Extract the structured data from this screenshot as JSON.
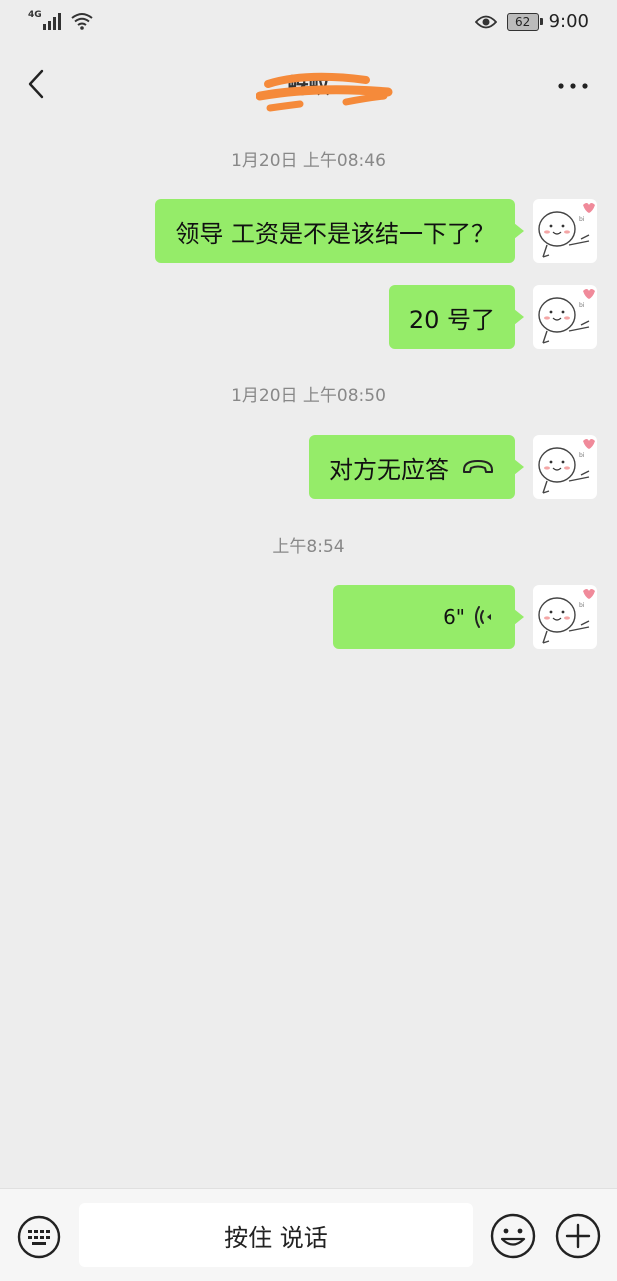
{
  "status_bar": {
    "network": "4G",
    "battery": "62",
    "time": "9:00"
  },
  "header": {
    "title": "蚜蚊"
  },
  "messages": [
    {
      "type": "timestamp",
      "text": "1月20日 上午08:46"
    },
    {
      "type": "text",
      "text": "领导  工资是不是该结一下了？"
    },
    {
      "type": "text",
      "text": "20 号了"
    },
    {
      "type": "timestamp",
      "text": "1月20日 上午08:50"
    },
    {
      "type": "call",
      "text": "对方无应答",
      "icon": "hangup-icon"
    },
    {
      "type": "timestamp",
      "text": "上午8:54"
    },
    {
      "type": "voice",
      "text": "6\"",
      "icon": "voice-wave-icon"
    }
  ],
  "input_bar": {
    "talk_label": "按住 说话"
  },
  "colors": {
    "bubble": "#95ec69",
    "background": "#ededed",
    "redaction": "#f58a3a"
  }
}
